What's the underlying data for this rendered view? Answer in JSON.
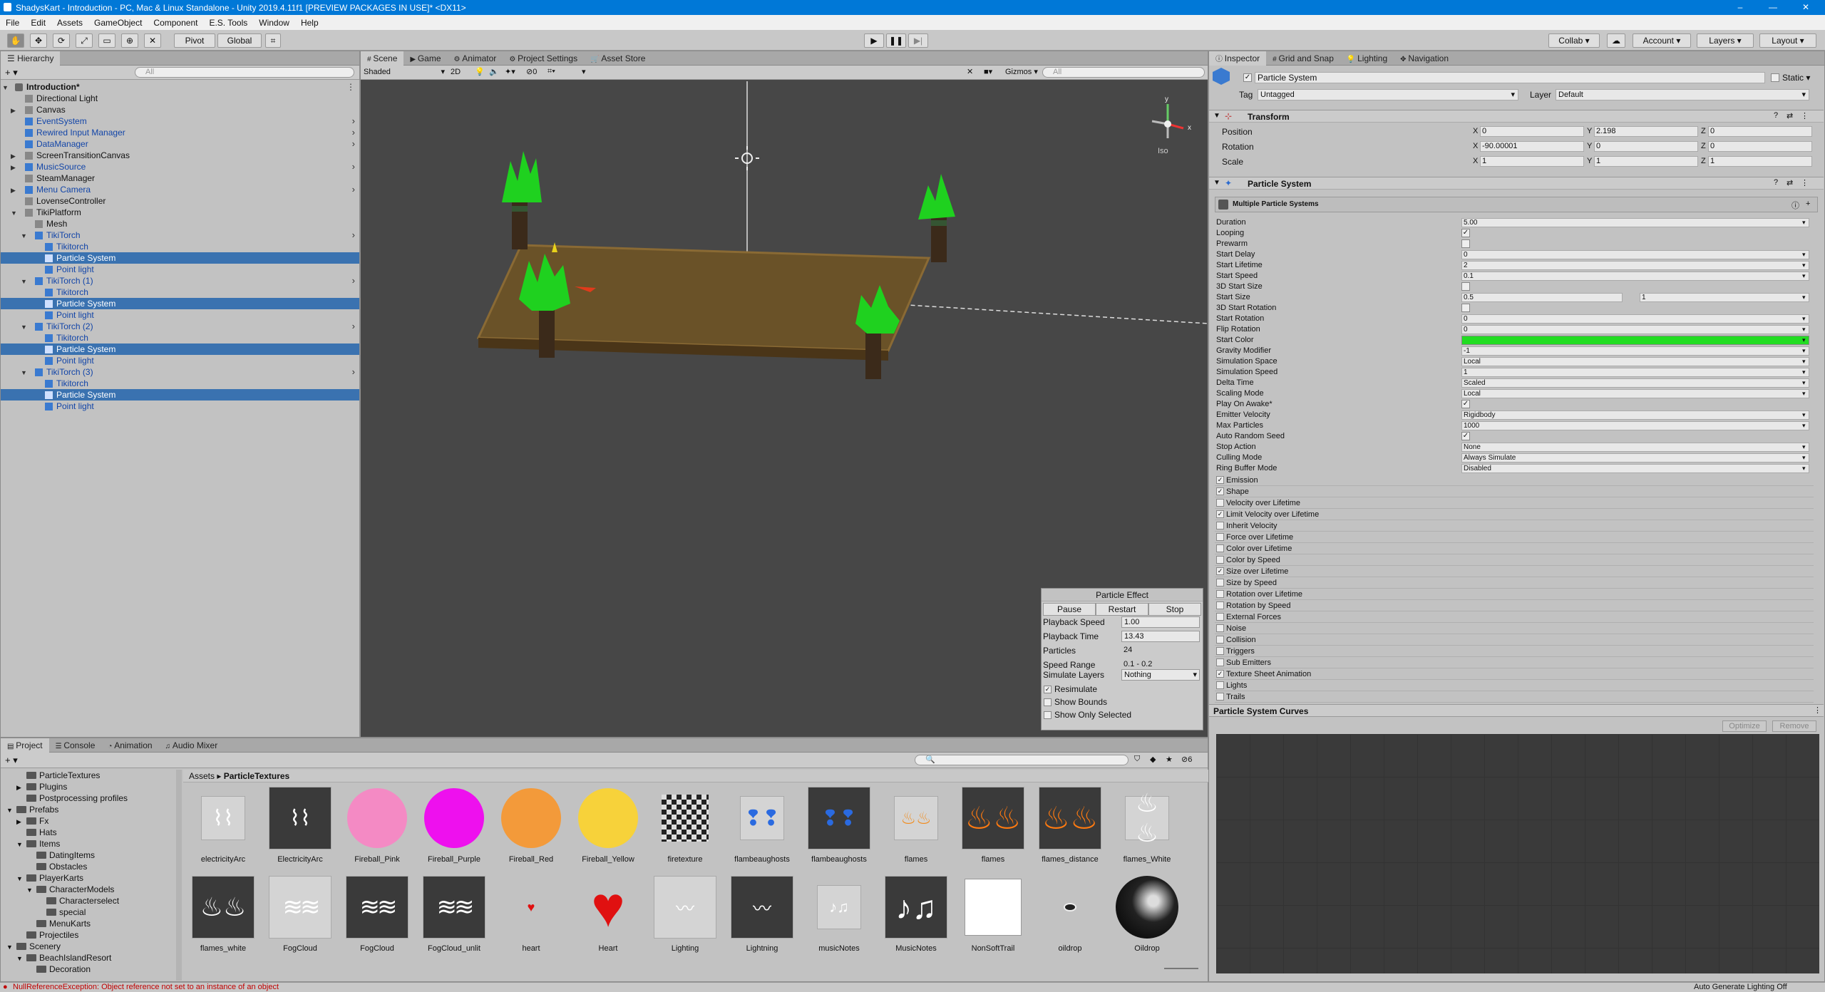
{
  "window": {
    "title": "ShadysKart - Introduction - PC, Mac & Linux Standalone - Unity 2019.4.11f1 [PREVIEW PACKAGES IN USE]* <DX11>"
  },
  "menu": [
    "File",
    "Edit",
    "Assets",
    "GameObject",
    "Component",
    "E.S. Tools",
    "Window",
    "Help"
  ],
  "toolbar": {
    "pivot": "Pivot",
    "global": "Global",
    "collab": "Collab",
    "account": "Account",
    "layers": "Layers",
    "layout": "Layout"
  },
  "hierarchy": {
    "tab": "Hierarchy",
    "search_placeholder": "All",
    "items": [
      {
        "label": "Introduction*",
        "depth": 0,
        "expand": "open",
        "bold": true,
        "prefab": false,
        "sel": false,
        "child": false
      },
      {
        "label": "Directional Light",
        "depth": 1,
        "expand": "",
        "bold": false,
        "prefab": false,
        "sel": false,
        "child": false
      },
      {
        "label": "Canvas",
        "depth": 1,
        "expand": "closed",
        "bold": false,
        "prefab": false,
        "sel": false,
        "child": false
      },
      {
        "label": "EventSystem",
        "depth": 1,
        "expand": "",
        "bold": false,
        "prefab": true,
        "sel": false,
        "child": true
      },
      {
        "label": "Rewired Input Manager",
        "depth": 1,
        "expand": "",
        "bold": false,
        "prefab": true,
        "sel": false,
        "child": true
      },
      {
        "label": "DataManager",
        "depth": 1,
        "expand": "",
        "bold": false,
        "prefab": true,
        "sel": false,
        "child": true
      },
      {
        "label": "ScreenTransitionCanvas",
        "depth": 1,
        "expand": "closed",
        "bold": false,
        "prefab": false,
        "sel": false,
        "child": false
      },
      {
        "label": "MusicSource",
        "depth": 1,
        "expand": "closed",
        "bold": false,
        "prefab": true,
        "sel": false,
        "child": true
      },
      {
        "label": "SteamManager",
        "depth": 1,
        "expand": "",
        "bold": false,
        "prefab": false,
        "sel": false,
        "child": false
      },
      {
        "label": "Menu Camera",
        "depth": 1,
        "expand": "closed",
        "bold": false,
        "prefab": true,
        "sel": false,
        "child": true
      },
      {
        "label": "LovenseController",
        "depth": 1,
        "expand": "",
        "bold": false,
        "prefab": false,
        "sel": false,
        "child": false
      },
      {
        "label": "TikiPlatform",
        "depth": 1,
        "expand": "open",
        "bold": false,
        "prefab": false,
        "sel": false,
        "child": false
      },
      {
        "label": "Mesh",
        "depth": 2,
        "expand": "",
        "bold": false,
        "prefab": false,
        "sel": false,
        "child": false
      },
      {
        "label": "TikiTorch",
        "depth": 2,
        "expand": "open",
        "bold": false,
        "prefab": true,
        "sel": false,
        "child": true
      },
      {
        "label": "Tikitorch",
        "depth": 3,
        "expand": "",
        "bold": false,
        "prefab": true,
        "sel": false,
        "child": false
      },
      {
        "label": "Particle System",
        "depth": 3,
        "expand": "",
        "bold": false,
        "prefab": true,
        "sel": true,
        "child": false
      },
      {
        "label": "Point light",
        "depth": 3,
        "expand": "",
        "bold": false,
        "prefab": true,
        "sel": false,
        "child": false
      },
      {
        "label": "TikiTorch (1)",
        "depth": 2,
        "expand": "open",
        "bold": false,
        "prefab": true,
        "sel": false,
        "child": true
      },
      {
        "label": "Tikitorch",
        "depth": 3,
        "expand": "",
        "bold": false,
        "prefab": true,
        "sel": false,
        "child": false
      },
      {
        "label": "Particle System",
        "depth": 3,
        "expand": "",
        "bold": false,
        "prefab": true,
        "sel": true,
        "child": false
      },
      {
        "label": "Point light",
        "depth": 3,
        "expand": "",
        "bold": false,
        "prefab": true,
        "sel": false,
        "child": false
      },
      {
        "label": "TikiTorch (2)",
        "depth": 2,
        "expand": "open",
        "bold": false,
        "prefab": true,
        "sel": false,
        "child": true
      },
      {
        "label": "Tikitorch",
        "depth": 3,
        "expand": "",
        "bold": false,
        "prefab": true,
        "sel": false,
        "child": false
      },
      {
        "label": "Particle System",
        "depth": 3,
        "expand": "",
        "bold": false,
        "prefab": true,
        "sel": true,
        "child": false
      },
      {
        "label": "Point light",
        "depth": 3,
        "expand": "",
        "bold": false,
        "prefab": true,
        "sel": false,
        "child": false
      },
      {
        "label": "TikiTorch (3)",
        "depth": 2,
        "expand": "open",
        "bold": false,
        "prefab": true,
        "sel": false,
        "child": true
      },
      {
        "label": "Tikitorch",
        "depth": 3,
        "expand": "",
        "bold": false,
        "prefab": true,
        "sel": false,
        "child": false
      },
      {
        "label": "Particle System",
        "depth": 3,
        "expand": "",
        "bold": false,
        "prefab": true,
        "sel": true,
        "child": false
      },
      {
        "label": "Point light",
        "depth": 3,
        "expand": "",
        "bold": false,
        "prefab": true,
        "sel": false,
        "child": false
      }
    ]
  },
  "scene": {
    "tabs": [
      "Scene",
      "Game",
      "Animator",
      "Project Settings",
      "Asset Store"
    ],
    "shading": "Shaded",
    "mode2d": "2D",
    "hidden_count": "0",
    "gizmos": "Gizmos",
    "search_placeholder": "All",
    "iso": "Iso"
  },
  "particle_effect": {
    "title": "Particle Effect",
    "pause": "Pause",
    "restart": "Restart",
    "stop": "Stop",
    "rows": [
      {
        "label": "Playback Speed",
        "value": "1.00",
        "field": true
      },
      {
        "label": "Playback Time",
        "value": "13.43",
        "field": true
      },
      {
        "label": "Particles",
        "value": "24",
        "field": false
      },
      {
        "label": "Speed Range",
        "value": "0.1 - 0.2",
        "field": false
      }
    ],
    "simulate_layers_label": "Simulate Layers",
    "simulate_layers_value": "Nothing",
    "checks": [
      {
        "label": "Resimulate",
        "checked": true
      },
      {
        "label": "Show Bounds",
        "checked": false
      },
      {
        "label": "Show Only Selected",
        "checked": false
      }
    ]
  },
  "inspector": {
    "tabs": [
      "Inspector",
      "Grid and Snap",
      "Lighting",
      "Navigation"
    ],
    "object_name": "Particle System",
    "static_label": "Static",
    "tag_label": "Tag",
    "tag_value": "Untagged",
    "layer_label": "Layer",
    "layer_value": "Default",
    "transform": {
      "title": "Transform",
      "rows": [
        {
          "label": "Position",
          "x": "0",
          "y": "2.198",
          "z": "0"
        },
        {
          "label": "Rotation",
          "x": "-90.00001",
          "y": "0",
          "z": "0"
        },
        {
          "label": "Scale",
          "x": "1",
          "y": "1",
          "z": "1"
        }
      ]
    },
    "ps_title": "Particle System",
    "ps_sub": "Multiple Particle Systems",
    "props": [
      {
        "label": "Duration",
        "value": "5.00",
        "kind": "field"
      },
      {
        "label": "Looping",
        "value": "✓",
        "kind": "check"
      },
      {
        "label": "Prewarm",
        "value": "",
        "kind": "check"
      },
      {
        "label": "Start Delay",
        "value": "0",
        "kind": "field"
      },
      {
        "label": "Start Lifetime",
        "value": "2",
        "kind": "field"
      },
      {
        "label": "Start Speed",
        "value": "0.1",
        "kind": "field"
      },
      {
        "label": "3D Start Size",
        "value": "",
        "kind": "check"
      },
      {
        "label": "Start Size",
        "value": "0.5",
        "value2": "1",
        "kind": "two"
      },
      {
        "label": "3D Start Rotation",
        "value": "",
        "kind": "check"
      },
      {
        "label": "Start Rotation",
        "value": "0",
        "kind": "field"
      },
      {
        "label": "Flip Rotation",
        "value": "0",
        "kind": "field"
      },
      {
        "label": "Start Color",
        "value": "",
        "kind": "color"
      },
      {
        "label": "Gravity Modifier",
        "value": "-1",
        "kind": "field"
      },
      {
        "label": "Simulation Space",
        "value": "Local",
        "kind": "field"
      },
      {
        "label": "Simulation Speed",
        "value": "1",
        "kind": "field"
      },
      {
        "label": "Delta Time",
        "value": "Scaled",
        "kind": "field"
      },
      {
        "label": "Scaling Mode",
        "value": "Local",
        "kind": "field"
      },
      {
        "label": "Play On Awake*",
        "value": "✓",
        "kind": "check"
      },
      {
        "label": "Emitter Velocity",
        "value": "Rigidbody",
        "kind": "field"
      },
      {
        "label": "Max Particles",
        "value": "1000",
        "kind": "field"
      },
      {
        "label": "Auto Random Seed",
        "value": "✓",
        "kind": "check"
      },
      {
        "label": "Stop Action",
        "value": "None",
        "kind": "field"
      },
      {
        "label": "Culling Mode",
        "value": "Always Simulate",
        "kind": "field"
      },
      {
        "label": "Ring Buffer Mode",
        "value": "Disabled",
        "kind": "field"
      }
    ],
    "modules": [
      {
        "label": "Emission",
        "on": true
      },
      {
        "label": "Shape",
        "on": true
      },
      {
        "label": "Velocity over Lifetime",
        "on": false
      },
      {
        "label": "Limit Velocity over Lifetime",
        "on": true
      },
      {
        "label": "Inherit Velocity",
        "on": false
      },
      {
        "label": "Force over Lifetime",
        "on": false
      },
      {
        "label": "Color over Lifetime",
        "on": false
      },
      {
        "label": "Color by Speed",
        "on": false
      },
      {
        "label": "Size over Lifetime",
        "on": true
      },
      {
        "label": "Size by Speed",
        "on": false
      },
      {
        "label": "Rotation over Lifetime",
        "on": false
      },
      {
        "label": "Rotation by Speed",
        "on": false
      },
      {
        "label": "External Forces",
        "on": false
      },
      {
        "label": "Noise",
        "on": false
      },
      {
        "label": "Collision",
        "on": false
      },
      {
        "label": "Triggers",
        "on": false
      },
      {
        "label": "Sub Emitters",
        "on": false
      },
      {
        "label": "Texture Sheet Animation",
        "on": true
      },
      {
        "label": "Lights",
        "on": false
      },
      {
        "label": "Trails",
        "on": false
      }
    ],
    "curves_title": "Particle System Curves",
    "optimize": "Optimize",
    "remove": "Remove",
    "auto_generate": "Auto Generate Lighting Off"
  },
  "project": {
    "tabs": [
      "Project",
      "Console",
      "Animation",
      "Audio Mixer"
    ],
    "path_root": "Assets",
    "path_leaf": "ParticleTextures",
    "hidden_count": "6",
    "tree": [
      {
        "label": "ParticleTextures",
        "depth": 1,
        "exp": ""
      },
      {
        "label": "Plugins",
        "depth": 1,
        "exp": "closed"
      },
      {
        "label": "Postprocessing profiles",
        "depth": 1,
        "exp": ""
      },
      {
        "label": "Prefabs",
        "depth": 0,
        "exp": "open"
      },
      {
        "label": "Fx",
        "depth": 1,
        "exp": "closed"
      },
      {
        "label": "Hats",
        "depth": 1,
        "exp": ""
      },
      {
        "label": "Items",
        "depth": 1,
        "exp": "open"
      },
      {
        "label": "DatingItems",
        "depth": 2,
        "exp": ""
      },
      {
        "label": "Obstacles",
        "depth": 2,
        "exp": ""
      },
      {
        "label": "PlayerKarts",
        "depth": 1,
        "exp": "open"
      },
      {
        "label": "CharacterModels",
        "depth": 2,
        "exp": "open"
      },
      {
        "label": "Characterselect",
        "depth": 3,
        "exp": ""
      },
      {
        "label": "special",
        "depth": 3,
        "exp": ""
      },
      {
        "label": "MenuKarts",
        "depth": 2,
        "exp": ""
      },
      {
        "label": "Projectiles",
        "depth": 1,
        "exp": ""
      },
      {
        "label": "Scenery",
        "depth": 0,
        "exp": "open"
      },
      {
        "label": "BeachIslandResort",
        "depth": 1,
        "exp": "open"
      },
      {
        "label": "Decoration",
        "depth": 2,
        "exp": ""
      }
    ],
    "assets": [
      {
        "name": "electricityArc",
        "kind": "arc"
      },
      {
        "name": "ElectricityArc",
        "kind": "arc-dark"
      },
      {
        "name": "Fireball_Pink",
        "kind": "ball",
        "color": "#f48ac4"
      },
      {
        "name": "Fireball_Purple",
        "kind": "ball",
        "color": "#ee10ee"
      },
      {
        "name": "Fireball_Red",
        "kind": "ball",
        "color": "#f39a3a"
      },
      {
        "name": "Fireball_Yellow",
        "kind": "ball",
        "color": "#f7d23a"
      },
      {
        "name": "firetexture",
        "kind": "noise"
      },
      {
        "name": "flambeaughosts",
        "kind": "ghost-light"
      },
      {
        "name": "flambeaughosts",
        "kind": "ghost-dark"
      },
      {
        "name": "flames",
        "kind": "flames-light"
      },
      {
        "name": "flames",
        "kind": "flames-dark"
      },
      {
        "name": "flames_distance",
        "kind": "flames-dark2"
      },
      {
        "name": "flames_White",
        "kind": "white-light"
      },
      {
        "name": "flames_white",
        "kind": "white-dark"
      },
      {
        "name": "FogCloud",
        "kind": "fog-light"
      },
      {
        "name": "FogCloud",
        "kind": "fog-dark"
      },
      {
        "name": "FogCloud_unlit",
        "kind": "fog-dark"
      },
      {
        "name": "heart",
        "kind": "heart-small"
      },
      {
        "name": "Heart",
        "kind": "heart"
      },
      {
        "name": "Lighting",
        "kind": "light-light"
      },
      {
        "name": "Lightning",
        "kind": "light-dark"
      },
      {
        "name": "musicNotes",
        "kind": "notes-light"
      },
      {
        "name": "MusicNotes",
        "kind": "notes-dark"
      },
      {
        "name": "NonSoftTrail",
        "kind": "trail"
      },
      {
        "name": "oildrop",
        "kind": "oil"
      },
      {
        "name": "Oildrop",
        "kind": "oil-big"
      }
    ]
  },
  "status": {
    "error": "NullReferenceException: Object reference not set to an instance of an object"
  },
  "colors": {
    "selection": "#3a72b0",
    "start_color": "#22dd22",
    "error": "#c00000",
    "titlebar": "#0078d7"
  }
}
